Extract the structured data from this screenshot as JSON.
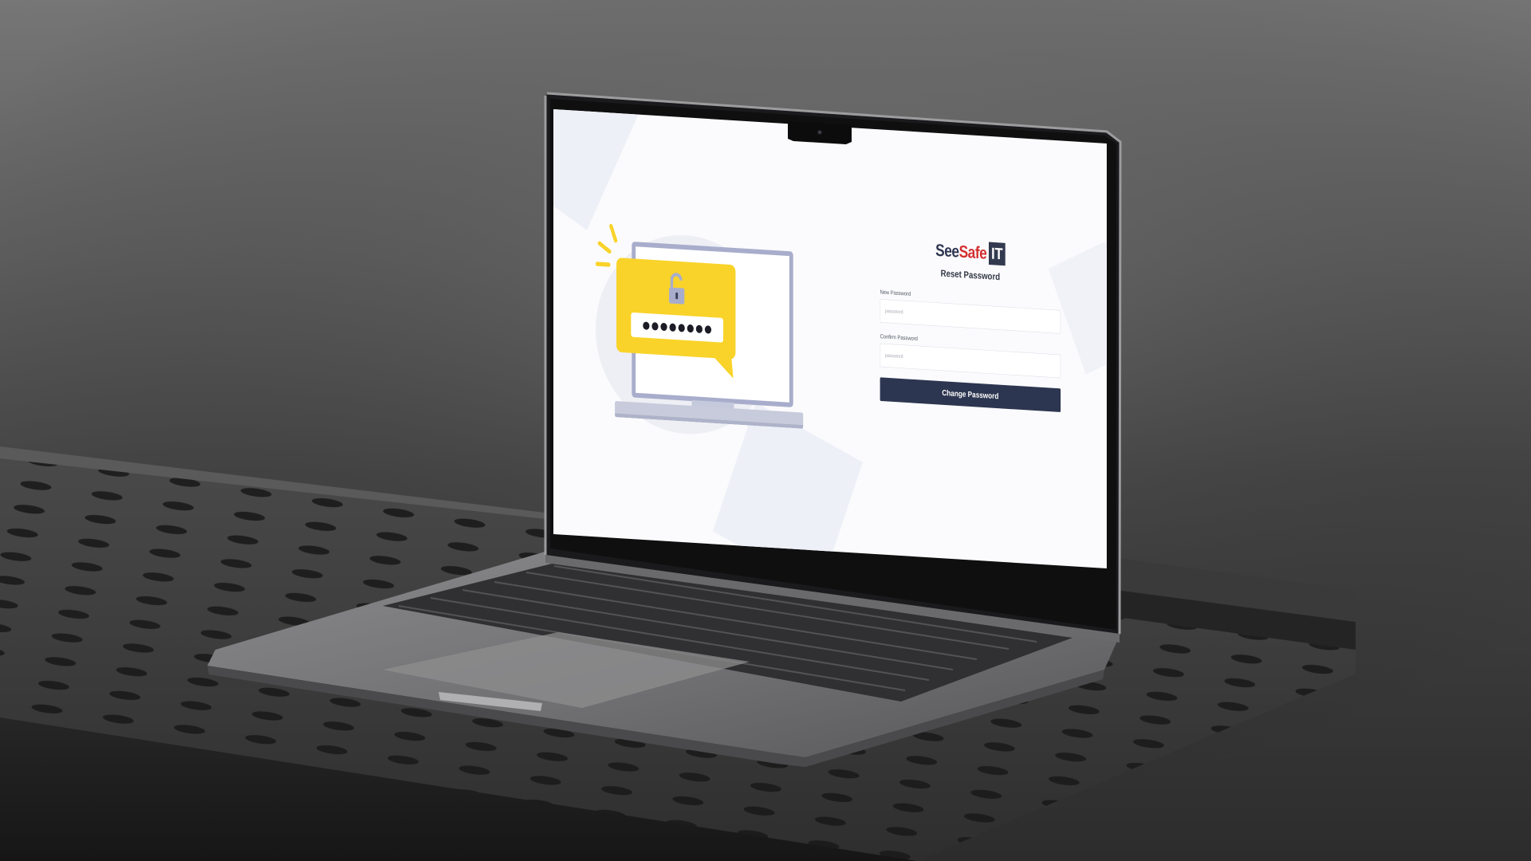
{
  "brand": {
    "see": "See",
    "safe": "Safe",
    "it": "IT"
  },
  "form": {
    "title": "Reset Password",
    "new_password_label": "New Password",
    "new_password_placeholder": "password",
    "confirm_password_label": "Confirm Password",
    "confirm_password_placeholder": "password",
    "submit_label": "Change Password"
  },
  "illustration": {
    "masked_dots": 8,
    "icon": "unlocked-padlock-icon"
  },
  "colors": {
    "brand_navy": "#2d3650",
    "brand_red": "#d32f2f",
    "illustration_yellow": "#f9d32a",
    "monitor_frame": "#a8adcc"
  }
}
